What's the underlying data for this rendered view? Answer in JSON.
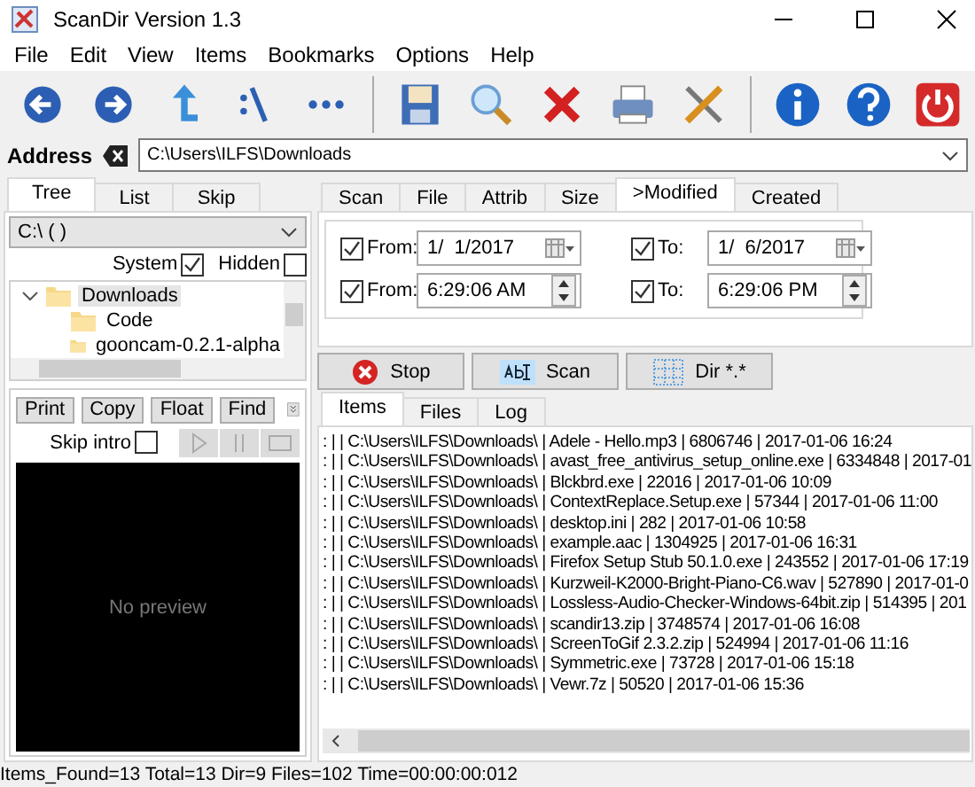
{
  "window": {
    "title": "ScanDir Version 1.3"
  },
  "menu": [
    "File",
    "Edit",
    "View",
    "Items",
    "Bookmarks",
    "Options",
    "Help"
  ],
  "address": {
    "label": "Address",
    "value": "C:\\Users\\ILFS\\Downloads"
  },
  "left_tabs": [
    {
      "label": "Tree",
      "selected": true
    },
    {
      "label": "List",
      "selected": false
    },
    {
      "label": "Skip",
      "selected": false
    }
  ],
  "drive": {
    "value": "C:\\ ( )"
  },
  "options": [
    {
      "label": "System",
      "checked": true
    },
    {
      "label": "Hidden",
      "checked": false
    }
  ],
  "tree": [
    {
      "label": "Downloads",
      "selected": true,
      "expanded": true,
      "children": [
        {
          "label": "Code",
          "selected": false
        },
        {
          "label": "gooncam-0.2.1-alpha",
          "selected": false
        }
      ]
    }
  ],
  "preview_buttons": [
    "Print",
    "Copy",
    "Float",
    "Find"
  ],
  "skip_intro": {
    "label": "Skip intro",
    "checked": false
  },
  "preview": {
    "text": "No preview"
  },
  "filter_tabs": [
    {
      "label": "Scan",
      "selected": false
    },
    {
      "label": "File",
      "selected": false
    },
    {
      "label": "Attrib",
      "selected": false
    },
    {
      "label": "Size",
      "selected": false
    },
    {
      "label": ">Modified",
      "selected": true
    },
    {
      "label": "Created",
      "selected": false
    }
  ],
  "date_rows": [
    {
      "kind": "date",
      "from": {
        "label": "From:",
        "checked": true,
        "value": "1/  1/2017"
      },
      "to": {
        "label": "To:",
        "checked": true,
        "value": "1/  6/2017"
      }
    },
    {
      "kind": "time",
      "from": {
        "label": "From:",
        "checked": true,
        "value": "6:29:06 AM"
      },
      "to": {
        "label": "To:",
        "checked": true,
        "value": "6:29:06 PM"
      }
    }
  ],
  "actions": [
    {
      "kind": "stop",
      "label": "Stop"
    },
    {
      "kind": "scan",
      "label": "Scan"
    },
    {
      "kind": "dir",
      "label": "Dir *.*"
    }
  ],
  "result_tabs": [
    {
      "label": "Items",
      "selected": true
    },
    {
      "label": "Files",
      "selected": false
    },
    {
      "label": "Log",
      "selected": false
    }
  ],
  "results": [
    ": | | C:\\Users\\ILFS\\Downloads\\ | Adele - Hello.mp3 | 6806746 | 2017-01-06 16:24",
    ": | | C:\\Users\\ILFS\\Downloads\\ | avast_free_antivirus_setup_online.exe | 6334848 | 2017-01",
    ": | | C:\\Users\\ILFS\\Downloads\\ | Blckbrd.exe | 22016 | 2017-01-06 10:09",
    ": | | C:\\Users\\ILFS\\Downloads\\ | ContextReplace.Setup.exe | 57344 | 2017-01-06 11:00",
    ": | | C:\\Users\\ILFS\\Downloads\\ | desktop.ini | 282 | 2017-01-06 10:58",
    ": | | C:\\Users\\ILFS\\Downloads\\ | example.aac | 1304925 | 2017-01-06 16:31",
    ": | | C:\\Users\\ILFS\\Downloads\\ | Firefox Setup Stub 50.1.0.exe | 243552 | 2017-01-06 17:19",
    ": | | C:\\Users\\ILFS\\Downloads\\ | Kurzweil-K2000-Bright-Piano-C6.wav | 527890 | 2017-01-0",
    ": | | C:\\Users\\ILFS\\Downloads\\ | Lossless-Audio-Checker-Windows-64bit.zip | 514395 | 201",
    ": | | C:\\Users\\ILFS\\Downloads\\ | scandir13.zip | 3748574 | 2017-01-06 16:08",
    ": | | C:\\Users\\ILFS\\Downloads\\ | ScreenToGif 2.3.2.zip | 524994 | 2017-01-06 11:16",
    ": | | C:\\Users\\ILFS\\Downloads\\ | Symmetric.exe | 73728 | 2017-01-06 15:18",
    ": | | C:\\Users\\ILFS\\Downloads\\ | Vewr.7z | 50520 | 2017-01-06 15:36"
  ],
  "status_bar": "Items_Found=13 Total=13 Dir=9 Files=102 Time=00:00:00:012"
}
